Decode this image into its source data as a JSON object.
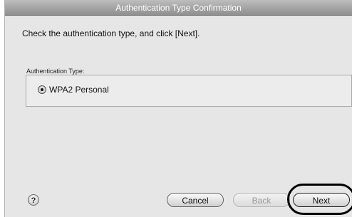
{
  "window": {
    "title": "Authentication Type Confirmation"
  },
  "content": {
    "instruction": "Check the authentication type, and click [Next].",
    "auth_type_label": "Authentication Type:",
    "auth_option": {
      "label": "WPA2 Personal",
      "selected": true
    }
  },
  "footer": {
    "help_label": "?",
    "cancel_label": "Cancel",
    "back_label": "Back",
    "next_label": "Next"
  }
}
